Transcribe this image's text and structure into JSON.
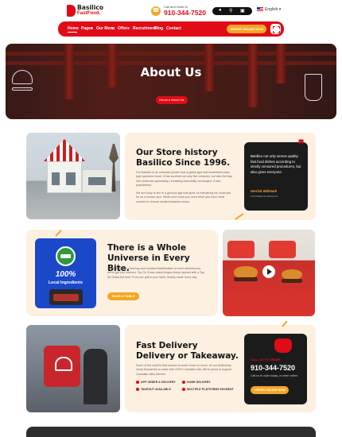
{
  "brand": {
    "name": "Basilico",
    "tagline": "FastFood."
  },
  "order": {
    "caption": "Call and Order in",
    "phone": "910-344-7520"
  },
  "header_tools": {
    "icons": [
      "user-icon",
      "search-icon",
      "cart-icon"
    ]
  },
  "language": {
    "label": "English"
  },
  "nav": {
    "items": [
      "Home",
      "Pages",
      "Our Menu",
      "Offers",
      "Recruitment",
      "Blog",
      "Contact"
    ],
    "cta": "ORDER ONLINE NOW"
  },
  "hero": {
    "title": "About Us",
    "breadcrumb": "Home ▸ About Us"
  },
  "story": {
    "title_line1": "Our Store history",
    "title_line2": "Basilico Since 1996.",
    "para1": "Our Basilico is an unknown printer took a galley type and scrambled make type specimen book. It has survived not only five centuries, but also the leap into electronic typesetting, remaining essentially unchanged. It was popularised.",
    "para2": "We are lucky to live in a glorious age that gives us everything we could ask for as a human race. What more could you need when you have meat covered in cheese nestled between bread.",
    "quote": "Basilico not only serves quality fast food dishes according to strictly censored procedures, but also gives everyone.",
    "author": "Derrick Widmark",
    "role": "FOUNDER OF BASILICO"
  },
  "universe": {
    "title_line1": "There is a Whole",
    "title_line2": "Universe in Every Bite.",
    "para": "Whether you're a ketchup and mustard traditionalist, or more adventurous, we've got you covered. Top Sir Grass-raised Angus ribeye layered with a Top Sir Grass-fed beef. From our grill to your table, freshly made every day.",
    "button": "BOOK A TABLE",
    "badge_text": "100%",
    "badge_label": "Local Ingredients"
  },
  "delivery": {
    "title_line1": "Fast Delivery",
    "title_line2": "Delivery or Takeaway.",
    "para": "Some of the world's best cheese is made closer to home. All our deliciously melty Mozzarella is made with 100% Canadian milk. We're proud to support Canadian dairy farmers.",
    "features": [
      "APP ORDER & DELIVERY",
      "HOME DELIVERY",
      "TAKEOUT AVAILABLE",
      "MULTIPLE PLATFORMS PAYMENT"
    ],
    "card_caption": "CALL US TO ORDER",
    "card_phone": "910-344-7520",
    "card_note": "Call us to order today, or order online.",
    "card_button": "ORDER ONLINE NOW"
  },
  "colors": {
    "brand_red": "#e10b17",
    "accent_orange": "#f5a623",
    "panel_cream": "#fdf0e0",
    "dark": "#1b1b1b"
  }
}
